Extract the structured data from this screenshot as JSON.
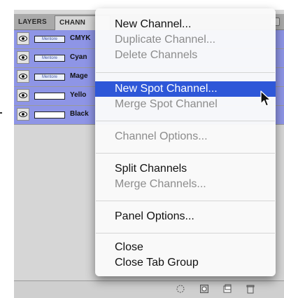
{
  "panel": {
    "tabs": [
      {
        "label": "LAYERS"
      },
      {
        "label": "CHANN"
      }
    ],
    "rows": [
      {
        "thumb": "Mentore",
        "label": "CMYK",
        "selected": true
      },
      {
        "thumb": "Mentore",
        "label": "Cyan",
        "selected": true
      },
      {
        "thumb": "Mentore",
        "label": "Mage",
        "selected": true
      },
      {
        "thumb": "",
        "label": "Yello",
        "selected": true
      },
      {
        "thumb": "",
        "label": "Black",
        "selected": true
      }
    ]
  },
  "menu": {
    "items": [
      {
        "label": "New Channel...",
        "enabled": true,
        "highlighted": false
      },
      {
        "label": "Duplicate Channel...",
        "enabled": false,
        "highlighted": false
      },
      {
        "label": "Delete Channels",
        "enabled": false,
        "highlighted": false
      },
      {
        "label": "New Spot Channel...",
        "enabled": true,
        "highlighted": true
      },
      {
        "label": "Merge Spot Channel",
        "enabled": false,
        "highlighted": false
      },
      {
        "label": "Channel Options...",
        "enabled": false,
        "highlighted": false
      },
      {
        "label": "Split Channels",
        "enabled": true,
        "highlighted": false
      },
      {
        "label": "Merge Channels...",
        "enabled": false,
        "highlighted": false
      },
      {
        "label": "Panel Options...",
        "enabled": true,
        "highlighted": false
      },
      {
        "label": "Close",
        "enabled": true,
        "highlighted": false
      },
      {
        "label": "Close Tab Group",
        "enabled": true,
        "highlighted": false
      }
    ]
  },
  "colors": {
    "selection_row": "#8e95e6",
    "menu_highlight": "#2e57d8",
    "disabled_text": "#8c8c8c"
  },
  "icons": [
    "eye-icon",
    "load-selection-icon",
    "save-selection-icon",
    "new-channel-icon",
    "trash-icon",
    "panel-menu-icon",
    "cursor-icon"
  ]
}
